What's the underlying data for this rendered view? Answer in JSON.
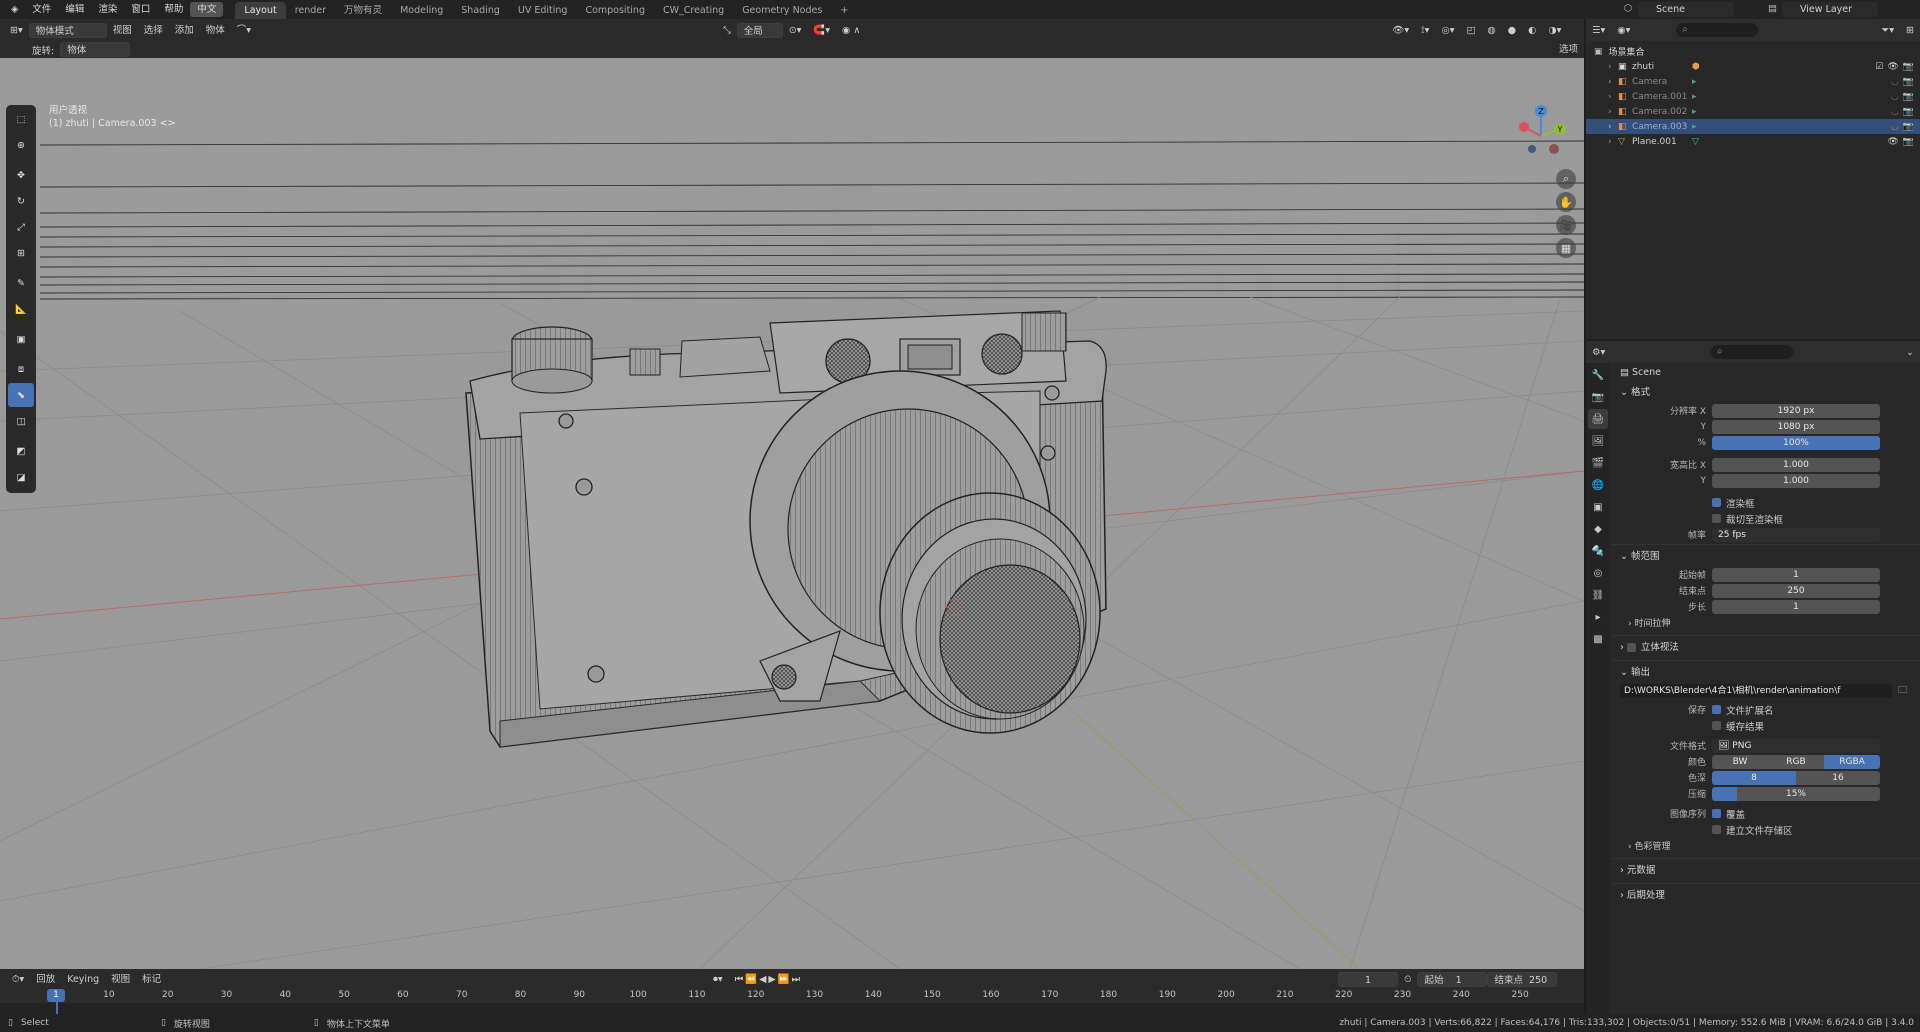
{
  "menubar": {
    "items": [
      "文件",
      "编辑",
      "渲染",
      "窗口",
      "帮助"
    ],
    "lang": "中文"
  },
  "workspaces": [
    "Layout",
    "render",
    "万物有灵",
    "Modeling",
    "Shading",
    "UV Editing",
    "Compositing",
    "CW_Creating",
    "Geometry Nodes"
  ],
  "workspace_add": "+",
  "scene": {
    "label": "Scene"
  },
  "view_layer": {
    "label": "View Layer"
  },
  "viewport": {
    "mode": "物体模式",
    "menus": [
      "视图",
      "选择",
      "添加",
      "物体"
    ],
    "orientation": "全局",
    "transform_label": "旋转:",
    "transform_value": "物体",
    "options": "选项",
    "info_line1": "用户透视",
    "info_line2": "(1) zhuti | Camera.003 <>",
    "gizmo": {
      "x": "X",
      "y": "Y",
      "z": "Z"
    }
  },
  "outliner": {
    "root": "场景集合",
    "rows": [
      {
        "name": "zhuti",
        "selected": false
      },
      {
        "name": "Camera",
        "selected": false
      },
      {
        "name": "Camera.001",
        "selected": false
      },
      {
        "name": "Camera.002",
        "selected": false
      },
      {
        "name": "Camera.003",
        "selected": true
      },
      {
        "name": "Plane.001",
        "selected": false
      }
    ]
  },
  "properties": {
    "context": "Scene",
    "format": {
      "title": "格式",
      "res_x_label": "分辨率 X",
      "res_x": "1920 px",
      "res_y_label": "Y",
      "res_y": "1080 px",
      "pct_label": "%",
      "pct": "100%",
      "aspect_x_label": "宽高比 X",
      "aspect_x": "1.000",
      "aspect_y_label": "Y",
      "aspect_y": "1.000",
      "render_region": "渲染框",
      "crop": "裁切至渲染框",
      "fps_label": "帧率",
      "fps": "25 fps"
    },
    "frame_range": {
      "title": "帧范围",
      "start_label": "起始帧",
      "start": "1",
      "end_label": "结束点",
      "end": "250",
      "step_label": "步长",
      "step": "1",
      "time_stretch": "时间拉伸"
    },
    "stereo": "立体视法",
    "output": {
      "title": "输出",
      "path": "D:\\WORKS\\Blender\\4合1\\相机\\render\\animation\\f",
      "save_label": "保存",
      "file_ext": "文件扩展名",
      "cache": "缓存结果",
      "format_label": "文件格式",
      "format": "PNG",
      "color_label": "颜色",
      "color_bw": "BW",
      "color_rgb": "RGB",
      "color_rgba": "RGBA",
      "depth_label": "色深",
      "depth_8": "8",
      "depth_16": "16",
      "compress_label": "压缩",
      "compress": "15%",
      "seq_label": "图像序列",
      "overwrite": "覆盖",
      "placeholders": "建立文件存储区",
      "color_management": "色彩管理"
    },
    "metadata": "元数据",
    "post": "后期处理"
  },
  "timeline": {
    "menus": [
      "回放",
      "Keying",
      "视图",
      "标记"
    ],
    "current": "1",
    "start_label": "起始",
    "start": "1",
    "end_label": "结束点",
    "end": "250",
    "ticks": [
      "10",
      "20",
      "30",
      "40",
      "50",
      "60",
      "70",
      "80",
      "90",
      "100",
      "110",
      "120",
      "130",
      "140",
      "150",
      "160",
      "170",
      "180",
      "190",
      "200",
      "210",
      "220",
      "230",
      "240",
      "250"
    ]
  },
  "status": {
    "select": "Select",
    "rotate": "旋转视图",
    "context": "物体上下文菜单",
    "stats": "zhuti | Camera.003 | Verts:66,822 | Faces:64,176 | Tris:133,302 | Objects:0/51 | Memory: 552.6 MiB | VRAM: 6.6/24.0 GiB | 3.4.0"
  },
  "colors": {
    "accent": "#4772b3",
    "bg": "#1d1d1d",
    "panel": "#282828",
    "viewport": "#3a3a3a"
  }
}
